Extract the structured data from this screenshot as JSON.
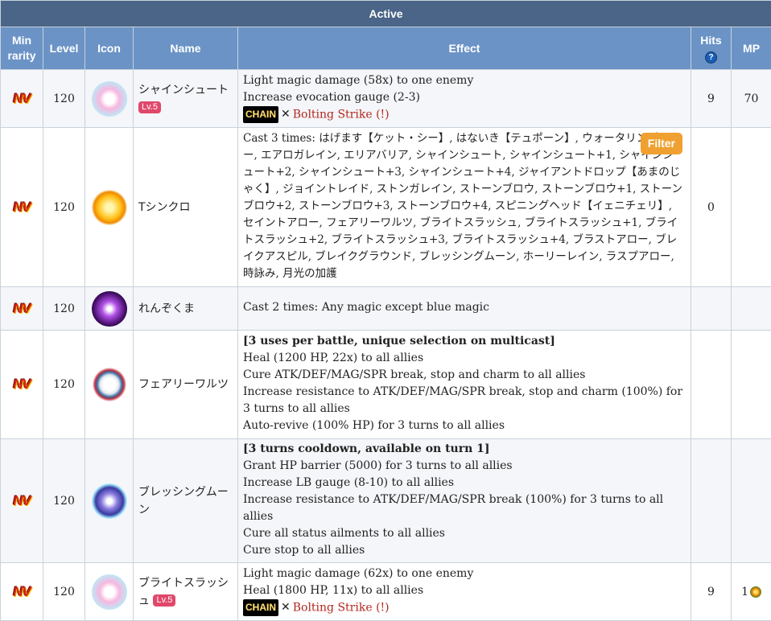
{
  "caption": "Active",
  "headers": {
    "min_rarity": "Min rarity",
    "level": "Level",
    "icon": "Icon",
    "name": "Name",
    "effect": "Effect",
    "hits": "Hits",
    "hits_help": "?",
    "mp": "MP"
  },
  "filter_label": "Filter",
  "rarity_label": "NV",
  "lv_badge": "Lv.5",
  "chain_label": "CHAIN",
  "rows": [
    {
      "level": "120",
      "name": "シャインシュート",
      "effects": [
        "Light magic damage (58x) to one enemy",
        "Increase evocation gauge (2-3)"
      ],
      "chain": "Bolting Strike (!)",
      "hits": "9",
      "mp": "70"
    },
    {
      "level": "120",
      "name": "Tシンクロ",
      "effects": [
        "Cast 3 times: はげます【ケット・シー】, はないき【テュポーン】, ウォータリングアロー, エアロガレイン, エリアバリア, シャインシュート, シャインシュート+1, シャインシュート+2, シャインシュート+3, シャインシュート+4, ジャイアントドロップ【あまのじゃく】, ジョイントレイド, ストンガレイン, ストーンブロウ, ストーンブロウ+1, ストーンブロウ+2, ストーンブロウ+3, ストーンブロウ+4, スピニングヘッド【イェニチェリ】, セイントアロー, フェアリーワルツ, ブライトスラッシュ, ブライトスラッシュ+1, ブライトスラッシュ+2, ブライトスラッシュ+3, ブライトスラッシュ+4, ブラストアロー, ブレイクアスピル, ブレイクグラウンド, ブレッシングムーン, ホーリーレイン, ラスプアロー, 時詠み, 月光の加護"
      ],
      "hits": "0",
      "mp": ""
    },
    {
      "level": "120",
      "name": "れんぞくま",
      "effects": [
        "Cast 2 times: Any magic except blue magic"
      ],
      "hits": "",
      "mp": ""
    },
    {
      "level": "120",
      "name": "フェアリーワルツ",
      "effects": [
        "[3 uses per battle, unique selection on multicast]",
        "Heal (1200 HP, 22x) to all allies",
        "Cure ATK/DEF/MAG/SPR break, stop and charm to all allies",
        "Increase resistance to ATK/DEF/MAG/SPR break, stop and charm (100%) for 3 turns to all allies",
        "Auto-revive (100% HP) for 3 turns to all allies"
      ],
      "hits": "",
      "mp": ""
    },
    {
      "level": "120",
      "name": "ブレッシングムーン",
      "effects": [
        "[3 turns cooldown, available on turn 1]",
        "Grant HP barrier (5000) for 3 turns to all allies",
        "Increase LB gauge (8-10) to all allies",
        "Increase resistance to ATK/DEF/MAG/SPR break (100%) for 3 turns to all allies",
        "Cure all status ailments to all allies",
        "Cure stop to all allies"
      ],
      "hits": "",
      "mp": ""
    },
    {
      "level": "120",
      "name": "ブライトスラッシュ",
      "effects": [
        "Light magic damage (62x) to one enemy",
        "Heal (1800 HP, 11x) to all allies"
      ],
      "chain": "Bolting Strike (!)",
      "hits": "9",
      "mp": "1"
    }
  ]
}
